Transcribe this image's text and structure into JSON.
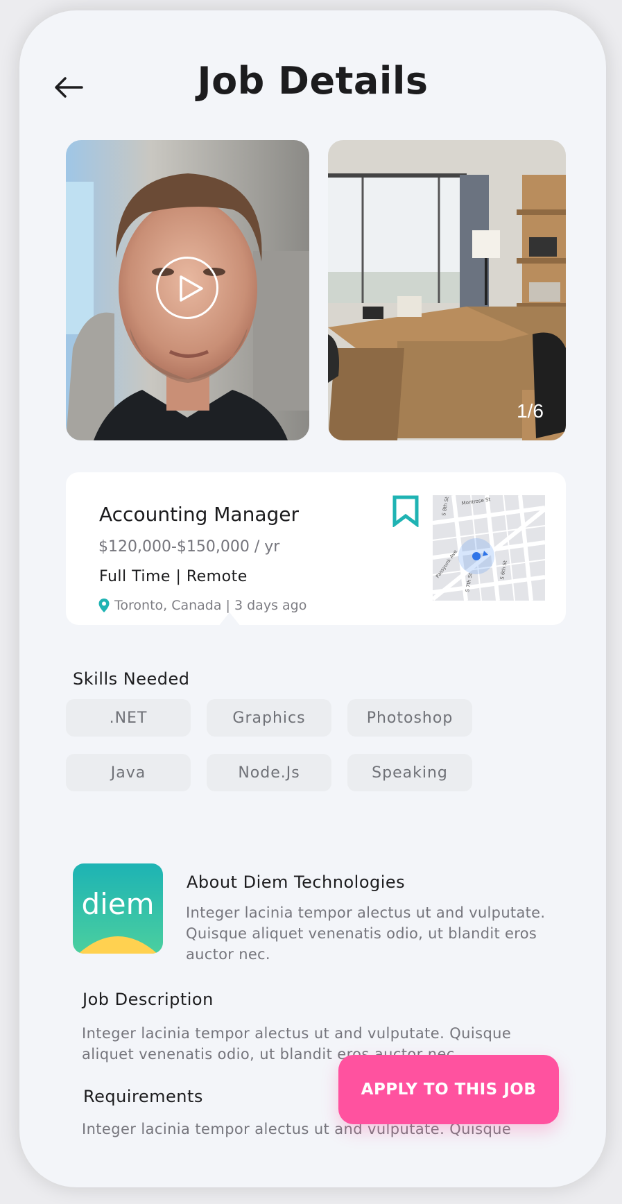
{
  "header": {
    "title": "Job Details"
  },
  "gallery": {
    "counter": "1/6"
  },
  "job": {
    "title": "Accounting Manager",
    "salary": "$120,000-$150,000 / yr",
    "type": "Full Time | Remote",
    "location": "Toronto, Canada | 3 days ago"
  },
  "map": {
    "street_labels": [
      "S 8th St",
      "Montrose St",
      "Passyunk Ave",
      "S 6th St",
      "S 7th St"
    ]
  },
  "skills": {
    "title": "Skills Needed",
    "items": [
      ".NET",
      "Graphics",
      "Photoshop",
      "Java",
      "Node.Js",
      "Speaking"
    ]
  },
  "company": {
    "logo_text": "diem",
    "about_title": "About Diem Technologies",
    "about_text": "Integer lacinia tempor alectus ut and vulputate. Quisque aliquet venenatis odio, ut blandit eros auctor nec."
  },
  "description": {
    "title": "Job Description",
    "text": "Integer lacinia tempor alectus ut and vulputate. Quisque aliquet venenatis odio, ut blandit eros auctor nec."
  },
  "requirements": {
    "title": "Requirements",
    "text": "Integer lacinia tempor alectus ut and vulputate. Quisque"
  },
  "cta": {
    "label": "APPLY TO THIS JOB"
  },
  "colors": {
    "accent": "#ff529f",
    "teal": "#1fb3b3",
    "background": "#f3f5f9"
  }
}
